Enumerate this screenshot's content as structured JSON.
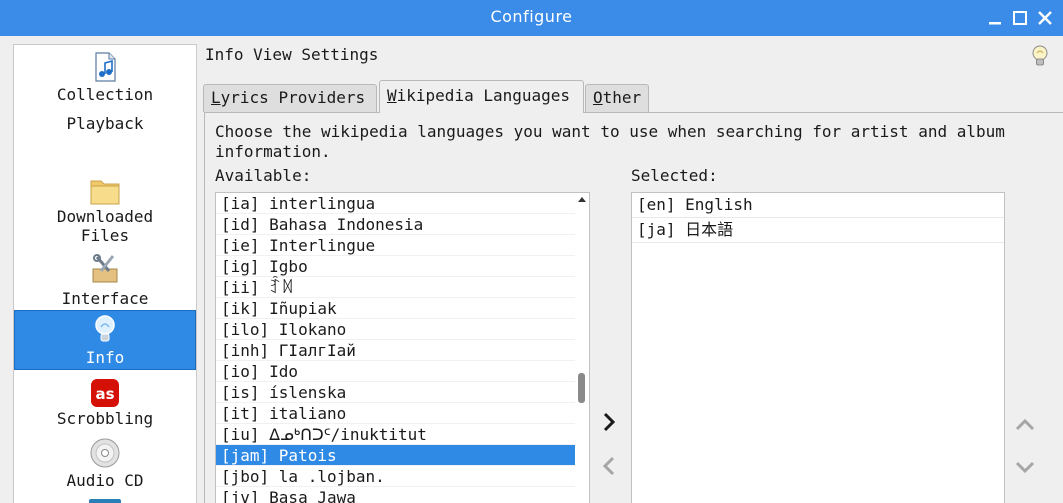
{
  "window": {
    "title": "Configure"
  },
  "sidebar": {
    "items": [
      {
        "label": "Collection",
        "icon": "music-file-icon"
      },
      {
        "label": "Playback",
        "icon": "playback-icon"
      },
      {
        "label": "Downloaded\nFiles",
        "icon": "folder-icon"
      },
      {
        "label": "Interface",
        "icon": "tools-icon"
      },
      {
        "label": "Info",
        "icon": "lightbulb-icon",
        "selected": true
      },
      {
        "label": "Scrobbling",
        "icon": "lastfm-icon"
      },
      {
        "label": "Audio CD",
        "icon": "cd-icon"
      }
    ]
  },
  "header": {
    "title": "Info View Settings"
  },
  "tabs": [
    {
      "label": "Lyrics Providers",
      "mnemonic": "L"
    },
    {
      "label": "Wikipedia Languages",
      "mnemonic": "W",
      "active": true
    },
    {
      "label": "Other",
      "mnemonic": "O"
    }
  ],
  "panel": {
    "description": "Choose the wikipedia languages you want to use when searching for artist and album information.",
    "available_label": "Available:",
    "selected_label": "Selected:"
  },
  "available": [
    "[ia] interlingua",
    "[id] Bahasa Indonesia",
    "[ie] Interlingue",
    "[ig] Igbo",
    "[ii] ꆇꉙ",
    "[ik] Iñupiak",
    "[ilo] Ilokano",
    "[inh] ГIалгIай",
    "[io] Ido",
    "[is] íslenska",
    "[it] italiano",
    "[iu] ᐃᓄᒃᑎᑐᑦ/inuktitut",
    "[jam] Patois",
    "[jbo] la .lojban.",
    "[jv] Basa Jawa"
  ],
  "available_selected_index": 12,
  "selected": [
    "[en] English",
    "[ja] 日本語"
  ],
  "colors": {
    "titlebar": "#3a8ce8",
    "selection": "#2f8ae6"
  }
}
